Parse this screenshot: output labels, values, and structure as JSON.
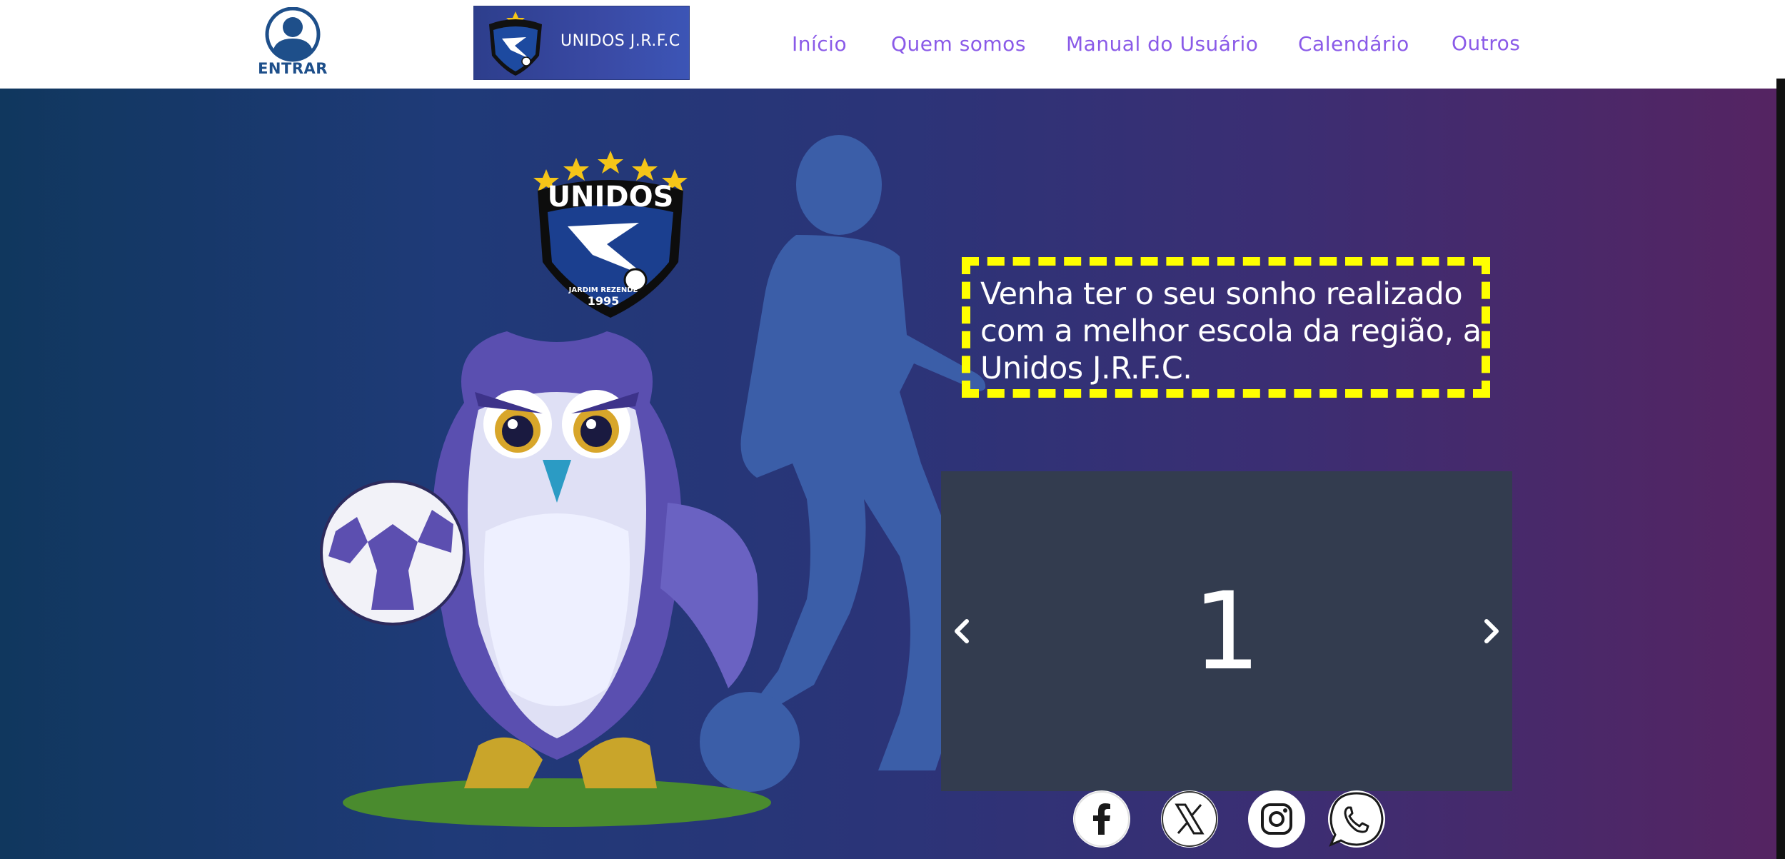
{
  "header": {
    "login_label": "ENTRAR",
    "brand_name": "UNIDOS J.R.F.C",
    "nav": [
      {
        "label": "Início"
      },
      {
        "label": "Quem somos"
      },
      {
        "label": "Manual do Usuário"
      },
      {
        "label": "Calendário"
      },
      {
        "label": "Outros"
      }
    ]
  },
  "hero": {
    "crest": {
      "name": "UNIDOS",
      "subtitle": "JARDIM REZENDE",
      "year": "1995"
    },
    "slogan": "Venha ter o seu sonho realizado com a melhor escola da região, a Unidos J.R.F.C.",
    "carousel": {
      "current_slide": "1",
      "prev_icon": "chevron-left-icon",
      "next_icon": "chevron-right-icon"
    }
  },
  "social": [
    {
      "icon": "facebook-icon"
    },
    {
      "icon": "x-twitter-icon"
    },
    {
      "icon": "instagram-icon"
    },
    {
      "icon": "whatsapp-icon"
    }
  ],
  "colors": {
    "nav_link": "#8a5ae8",
    "slogan_border": "#ffff00",
    "carousel_bg": "#333c4f",
    "login_blue": "#1e4f8a"
  }
}
